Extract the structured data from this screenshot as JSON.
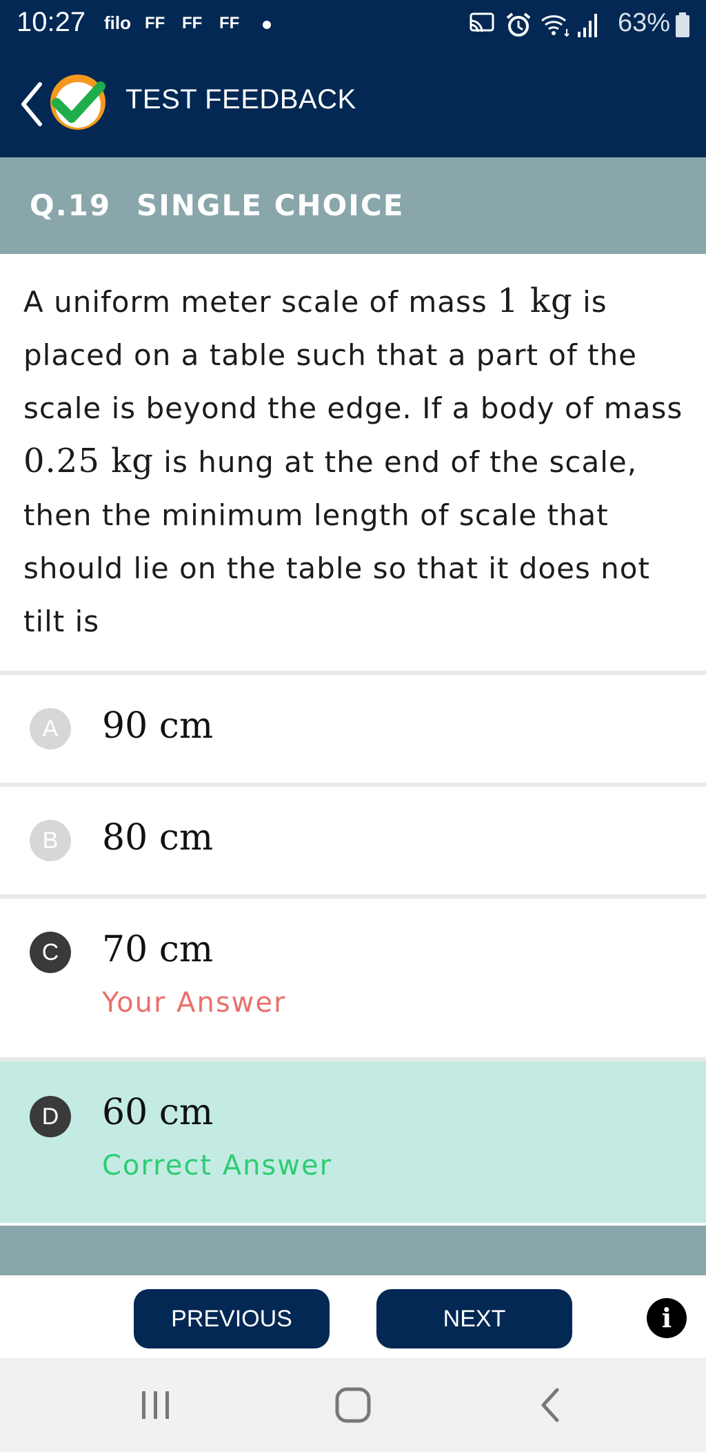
{
  "status_bar": {
    "time": "10:27",
    "app_label": "filo",
    "notifications": [
      "FF",
      "FF",
      "FF"
    ],
    "battery": "63%"
  },
  "header": {
    "title": "TEST FEEDBACK"
  },
  "question": {
    "number": "Q.19",
    "type": "SINGLE CHOICE",
    "text_part1": "A uniform meter scale of mass ",
    "math1": "1 kg",
    "text_part2": " is placed on a table such that a part of the scale is beyond the edge. If a body of mass ",
    "math2": "0.25 kg",
    "text_part3": " is hung at the end of the scale, then the minimum length of scale that should lie on the table so that it does not tilt is"
  },
  "options": [
    {
      "letter": "A",
      "value": "90 cm",
      "note": ""
    },
    {
      "letter": "B",
      "value": "80 cm",
      "note": ""
    },
    {
      "letter": "C",
      "value": "70 cm",
      "note": "Your Answer"
    },
    {
      "letter": "D",
      "value": "60 cm",
      "note": "Correct Answer"
    }
  ],
  "footer": {
    "previous_label": "PREVIOUS",
    "next_label": "NEXT",
    "info_label": "i"
  },
  "colors": {
    "primary": "#022853",
    "band": "#89a6ab",
    "correct_bg": "#c3ebe3",
    "correct_text": "#2ecc71",
    "wrong_text": "#e8706a"
  }
}
